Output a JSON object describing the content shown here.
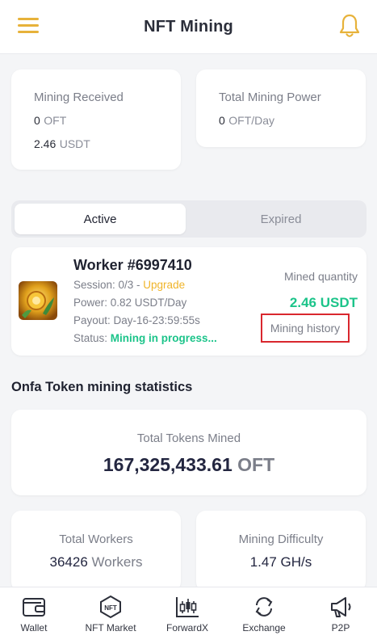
{
  "header": {
    "title": "NFT Mining",
    "menu_icon": "hamburger-menu-icon",
    "bell_icon": "bell-icon",
    "accent_color": "#e7b23a"
  },
  "summary": {
    "mining_received": {
      "label": "Mining Received",
      "lines": [
        {
          "value": "0",
          "unit": "OFT"
        },
        {
          "value": "2.46",
          "unit": "USDT"
        }
      ]
    },
    "total_power": {
      "label": "Total Mining Power",
      "value": "0",
      "unit": "OFT/Day"
    }
  },
  "tabs": {
    "active": "Active",
    "expired": "Expired"
  },
  "worker": {
    "name": "Worker #6997410",
    "session_label": "Session: 0/3 - ",
    "upgrade": "Upgrade",
    "power": "Power: 0.82 USDT/Day",
    "payout": "Payout: Day-16-23:59:55s",
    "status_label": "Status: ",
    "status_value": "Mining in progress...",
    "mined_label": "Mined quantity",
    "mined_value": "2.46 USDT",
    "history_button": "Mining history",
    "status_color": "#1cc48a",
    "upgrade_color": "#f0b429"
  },
  "statistics": {
    "title": "Onfa Token mining statistics",
    "total_tokens": {
      "label": "Total Tokens Mined",
      "value": "167,325,433.61",
      "unit": "OFT"
    },
    "total_workers": {
      "label": "Total Workers",
      "value": "36426",
      "unit": "Workers"
    },
    "difficulty": {
      "label": "Mining Difficulty",
      "value": "1.47 GH/s"
    }
  },
  "bottom_nav": [
    {
      "label": "Wallet",
      "icon": "wallet-icon"
    },
    {
      "label": "NFT Market",
      "icon": "nft-icon"
    },
    {
      "label": "ForwardX",
      "icon": "candlestick-chart-icon"
    },
    {
      "label": "Exchange",
      "icon": "exchange-icon"
    },
    {
      "label": "P2P",
      "icon": "megaphone-icon"
    }
  ]
}
